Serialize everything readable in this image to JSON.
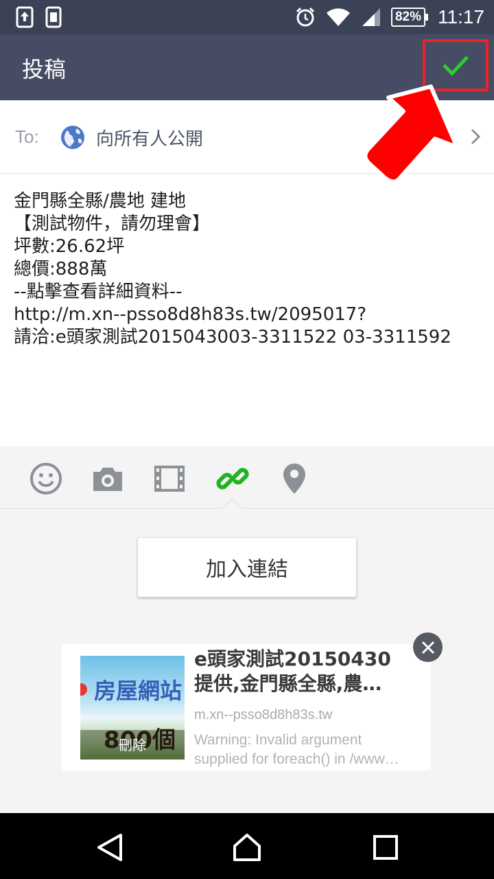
{
  "status_bar": {
    "battery": "82%",
    "time": "11:17",
    "icons": [
      "upload-notification-icon",
      "sim-notification-icon",
      "alarm-icon",
      "wifi-icon",
      "signal-icon",
      "battery-icon"
    ]
  },
  "action_bar": {
    "title": "投稿",
    "confirm_icon": "checkmark-icon",
    "confirm_color": "#2ecc2e",
    "highlight_color": "#e8232a"
  },
  "recipient": {
    "label": "To:",
    "value": "向所有人公開",
    "icon": "globe-icon"
  },
  "post": {
    "lines": [
      "金門縣全縣/農地 建地",
      "【測試物件，請勿理會】",
      "坪數:26.62坪",
      "總價:888萬",
      "--點擊查看詳細資料--",
      "http://m.xn--psso8d8h83s.tw/2095017?",
      "請洽:e頭家測試2015043003-3311522   03-3311592"
    ]
  },
  "toolbar": {
    "items": [
      "emoji-icon",
      "camera-icon",
      "video-icon",
      "link-icon",
      "location-icon"
    ],
    "active": "link-icon",
    "active_color": "#1fb41f"
  },
  "link_panel": {
    "add_link_label": "加入連結",
    "preview": {
      "thumb_text_top": "房屋網站",
      "thumb_text_bottom": "800個",
      "delete_label": "刪除",
      "title_lines": [
        "e頭家測試20150430",
        "提供,金門縣全縣,農…"
      ],
      "domain": "m.xn--psso8d8h83s.tw",
      "desc_lines": [
        "Warning: Invalid argument",
        "supplied for foreach() in /www…"
      ]
    }
  },
  "nav_bar": {
    "items": [
      "back-icon",
      "home-icon",
      "recents-icon"
    ]
  }
}
